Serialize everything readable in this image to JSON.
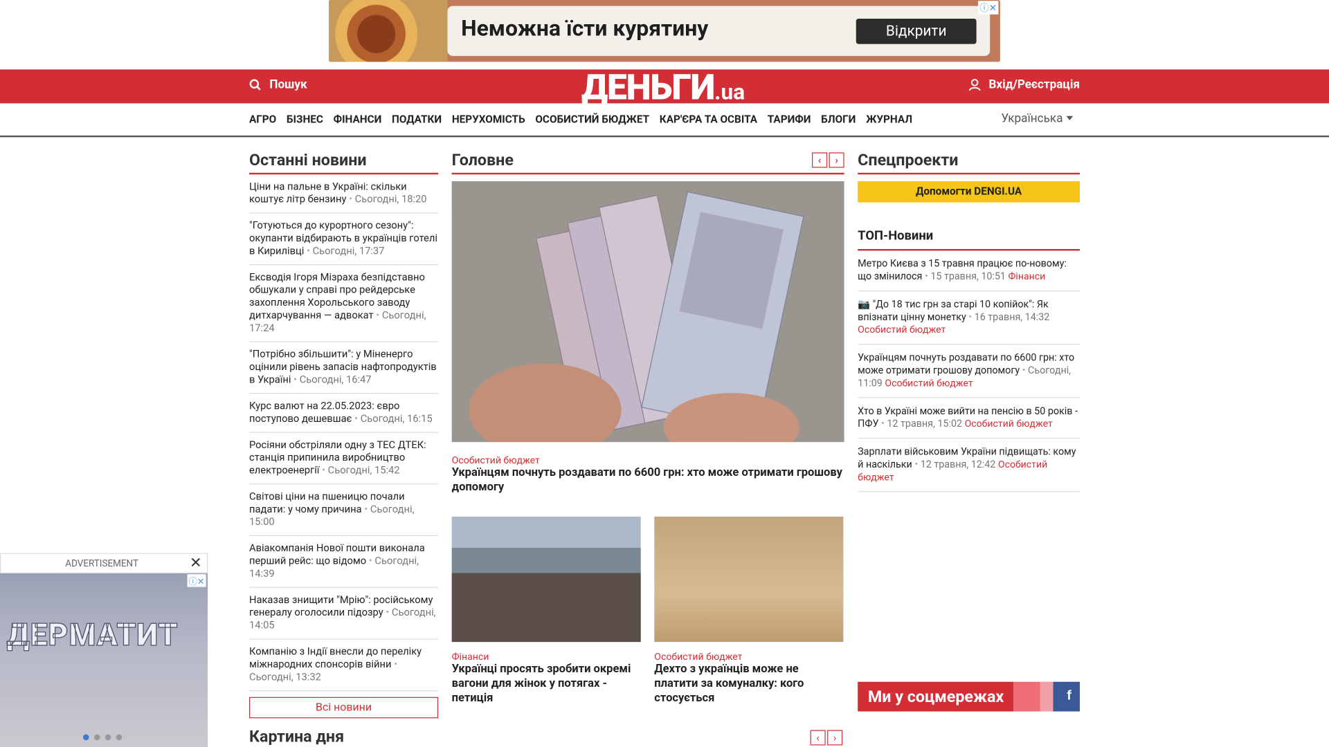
{
  "top_ad": {
    "title": "Неможна їсти курятину",
    "button": "Відкрити"
  },
  "header": {
    "search": "Пошук",
    "logo_main": "ДЕНЬГИ",
    "logo_suffix": ".ua",
    "login": "Вхід/Реєстрація"
  },
  "nav": {
    "items": [
      "АГРО",
      "БІЗНЕС",
      "ФІНАНСИ",
      "ПОДАТКИ",
      "НЕРУХОМІСТЬ",
      "ОСОБИСТИЙ БЮДЖЕТ",
      "КАР'ЄРА ТА ОСВІТА",
      "ТАРИФИ",
      "БЛОГИ",
      "ЖУРНАЛ"
    ],
    "language": "Українська"
  },
  "latest": {
    "title": "Останні новини",
    "items": [
      {
        "text": "Ціни на пальне в Україні: скільки коштує літр бензину",
        "time": "Сьогодні, 18:20"
      },
      {
        "text": "\"Готуються до курортного сезону\": окупанти відбирають в українців готелі в Кирилівці",
        "time": "Сьогодні, 17:37"
      },
      {
        "text": "Ексводія Ігоря Мізраха безпідставно обшукали у справі про рейдерське захоплення Хорольського заводу дитхарчування — адвокат",
        "time": "Сьогодні, 17:24"
      },
      {
        "text": "\"Потрібно збільшити\": у Міненерго оцінили рівень запасів нафтопродуктів в Україні",
        "time": "Сьогодні, 16:47"
      },
      {
        "text": "Курс валют на 22.05.2023: євро поступово дешевшає",
        "time": "Сьогодні, 16:15"
      },
      {
        "text": "Росіяни обстріляли одну з ТЕС ДТЕК: станція припинила виробництво електроенергії",
        "time": "Сьогодні, 15:42"
      },
      {
        "text": "Світові ціни на пшеницю почали падати: у чому причина",
        "time": "Сьогодні, 15:00"
      },
      {
        "text": "Авіакомпанія Нової пошти виконала перший рейс: що відомо",
        "time": "Сьогодні, 14:39"
      },
      {
        "text": "Наказав знищити \"Мрію\": російському генералу оголосили підозру",
        "time": "Сьогодні, 14:05"
      },
      {
        "text": "Компанію з Індії внесли до переліку міжнародних спонсорів війни",
        "time": "Сьогодні, 13:32"
      }
    ],
    "all_button": "Всі новини"
  },
  "main": {
    "title": "Головне",
    "hero": {
      "category": "Особистий бюджет",
      "headline": "Українцям почнуть роздавати по 6600 грн: хто може отримати грошову допомогу"
    },
    "cards": [
      {
        "category": "Фінанси",
        "headline": "Українці просять зробити окремі вагони для жінок у потягах - петиція"
      },
      {
        "category": "Особистий бюджет",
        "headline": "Дехто з українців може не платити за комуналку: кого стосується"
      }
    ]
  },
  "right": {
    "special_title": "Спецпроекти",
    "help_button": "Допомогти DENGI.UA",
    "top_title": "ТОП-Новини",
    "top_items": [
      {
        "text": "Метро Києва з 15 травня працює по-новому: що змінилося",
        "time": "15 травня, 10:51",
        "category": "Фінанси"
      },
      {
        "text": "\"До 18 тис грн за старі 10 копійок\": Як впізнати цінну монетку",
        "time": "16 травня, 14:32",
        "category": "Особистий бюджет"
      },
      {
        "text": "Українцям почнуть роздавати по 6600 грн: хто може отримати грошову допомогу",
        "time": "Сьогодні, 11:09",
        "category": "Особистий бюджет"
      },
      {
        "text": "Хто в Україні може вийти на пенсію в 50 років - ПФУ",
        "time": "12 травня, 15:02",
        "category": "Особистий бюджет"
      },
      {
        "text": "Зарплати військовим України підвищать: кому й наскільки",
        "time": "12 травня, 12:42",
        "category": "Особистий бюджет"
      }
    ],
    "social": "Ми у соцмережах"
  },
  "bottom": {
    "title": "Картина дня"
  },
  "side_ad": {
    "label": "ADVERTISEMENT",
    "word": "ДЕРМАТИТ"
  }
}
